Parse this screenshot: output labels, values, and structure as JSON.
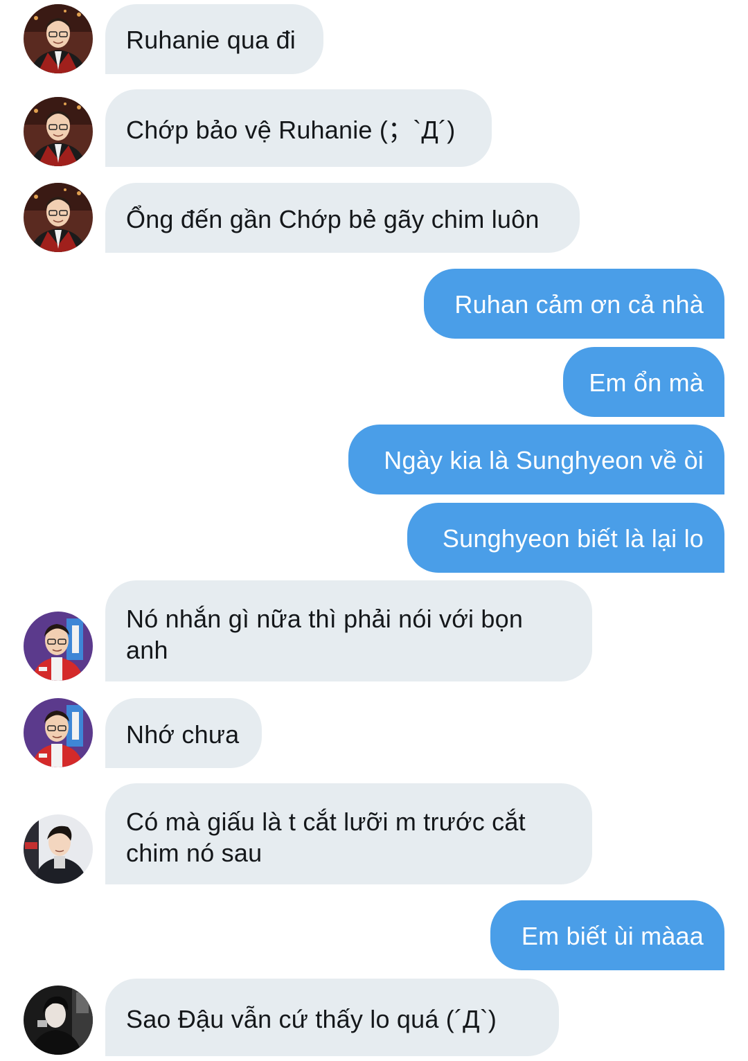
{
  "colors": {
    "incoming_bubble": "#e6ecf0",
    "outgoing_bubble": "#4a9ee8",
    "incoming_text": "#14171a",
    "outgoing_text": "#ffffff"
  },
  "messages": [
    {
      "side": "in",
      "avatar": "avatar-1",
      "text": "Ruhanie qua đi"
    },
    {
      "side": "in",
      "avatar": "avatar-1",
      "text": "Chớp bảo vệ Ruhanie (；`Д´)"
    },
    {
      "side": "in",
      "avatar": "avatar-1",
      "text": "Ổng đến gần Chớp bẻ gãy chim luôn"
    },
    {
      "side": "out",
      "text": "Ruhan cảm ơn cả nhà"
    },
    {
      "side": "out",
      "text": "Em ổn mà"
    },
    {
      "side": "out",
      "text": "Ngày kia là Sunghyeon về òi"
    },
    {
      "side": "out",
      "text": "Sunghyeon biết là lại lo"
    },
    {
      "side": "in",
      "avatar": "avatar-2",
      "text": "Nó nhắn gì nữa thì phải nói với bọn anh"
    },
    {
      "side": "in",
      "avatar": "avatar-2",
      "text": "Nhớ chưa"
    },
    {
      "side": "in",
      "avatar": "avatar-3",
      "text": "Có mà giấu là t cắt lưỡi m trước cắt chim nó sau"
    },
    {
      "side": "out",
      "text": "Em biết ùi màaa"
    },
    {
      "side": "in",
      "avatar": "avatar-4",
      "text": "Sao Đậu vẫn cứ thấy lo quá (´Д`)"
    }
  ]
}
